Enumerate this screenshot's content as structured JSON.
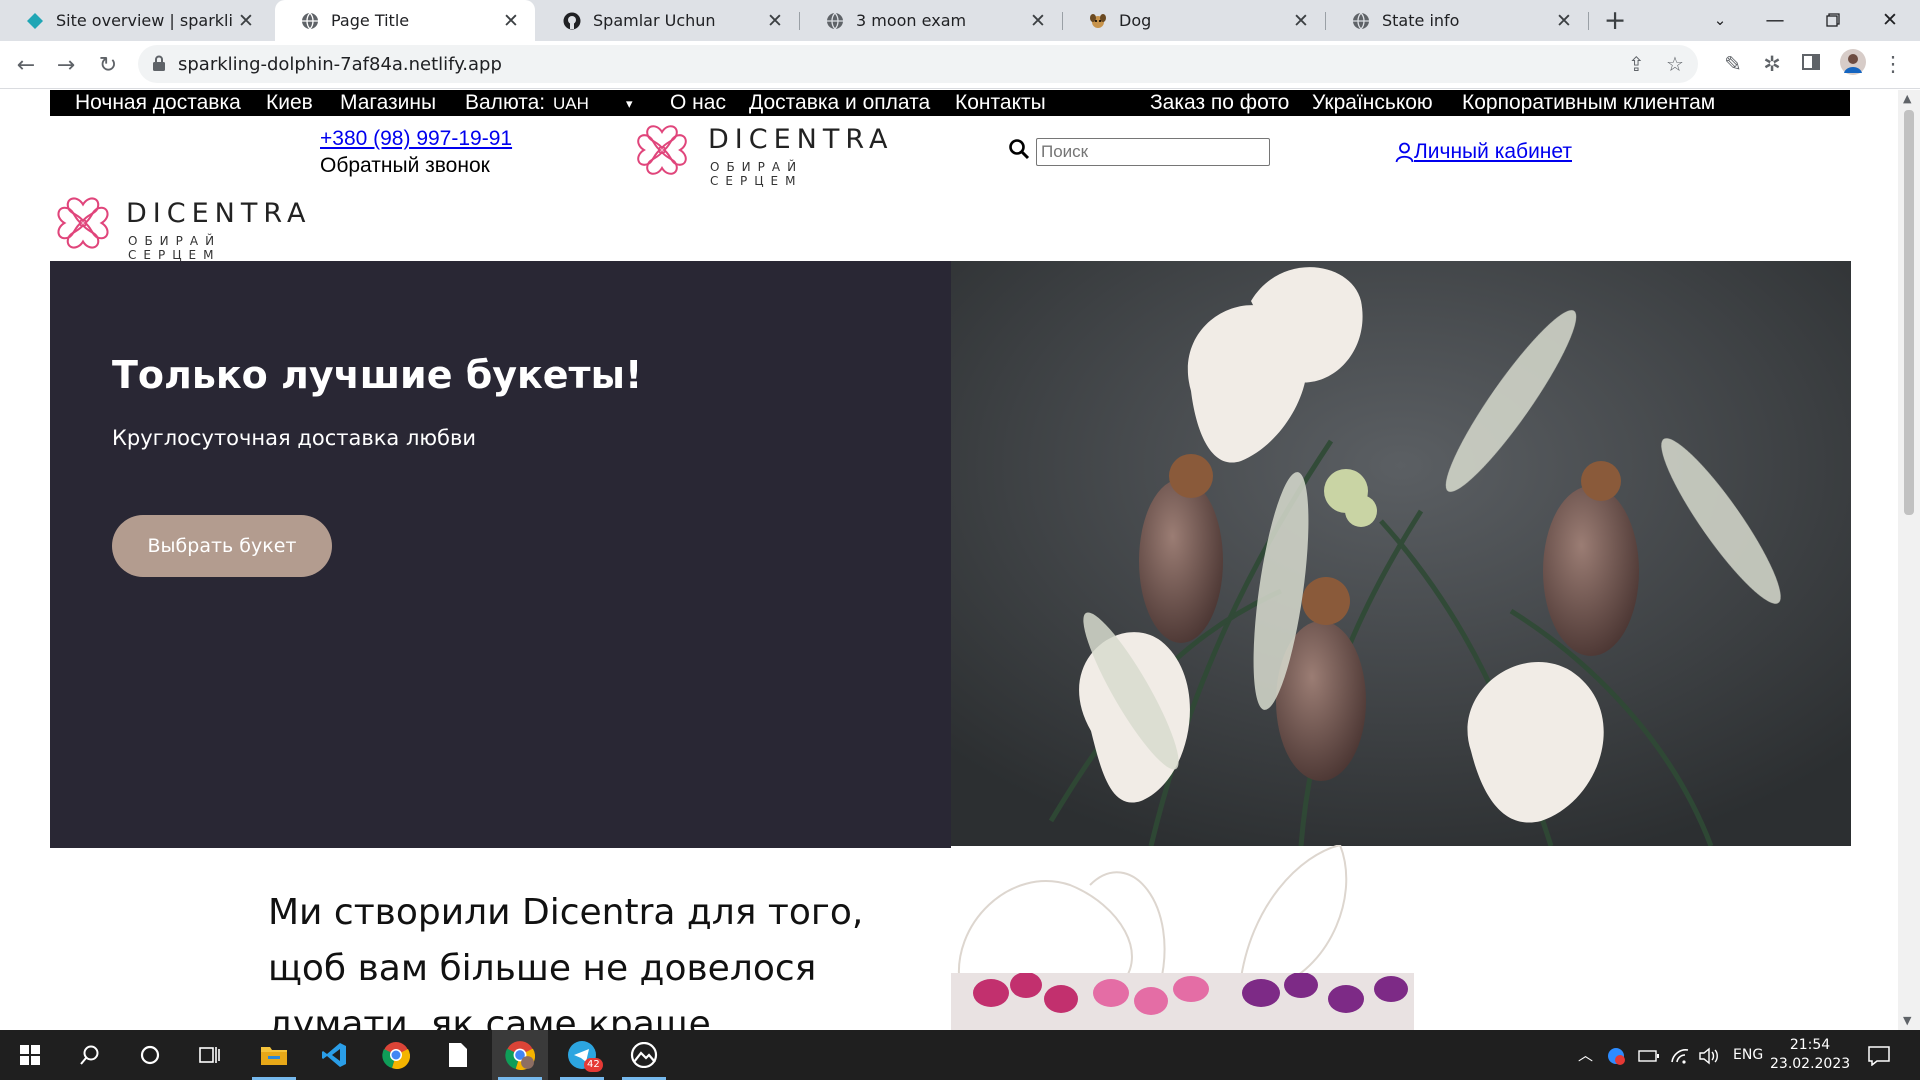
{
  "browser": {
    "tabs": [
      {
        "title": "Site overview | sparkling-dolphin",
        "icon": "netlify-icon",
        "active": false
      },
      {
        "title": "Page Title",
        "icon": "globe-icon",
        "active": true
      },
      {
        "title": "Spamlar Uchun",
        "icon": "github-icon",
        "active": false
      },
      {
        "title": "3 moon exam",
        "icon": "globe-icon",
        "active": false
      },
      {
        "title": "Dog",
        "icon": "dog-icon",
        "active": false
      },
      {
        "title": "State info",
        "icon": "globe-icon",
        "active": false
      }
    ],
    "url": "sparkling-dolphin-7af84a.netlify.app"
  },
  "site": {
    "topnav": {
      "items": [
        "Ночная доставка",
        "Киев",
        "Магазины",
        "Валюта:",
        "О нас",
        "Доставка и оплата",
        "Контакты",
        "Заказ по фото",
        "Українською",
        "Корпоративным клиентам"
      ],
      "currency_value": "UAH"
    },
    "header": {
      "phone": "+380 (98) 997-19-91",
      "callback": "Обратный звонок",
      "logo_word": "DICENTRA",
      "logo_tagline": "ОБИРАЙ СЕРЦЕМ",
      "search_placeholder": "Поиск",
      "account_label": "Личный кабинет"
    },
    "hero": {
      "title": "Только лучшие букеты!",
      "subtitle": "Круглосуточная доставка любви",
      "button": "Выбрать букет"
    },
    "about": {
      "text": "Ми створили Dicentra для того, щоб вам більше не довелося думати, як саме краще висловити"
    }
  },
  "taskbar": {
    "language": "ENG",
    "time": "21:54",
    "date": "23.02.2023",
    "telegram_badge": "42"
  },
  "colors": {
    "hero_bg": "#292734",
    "hero_button": "#b39c8f",
    "logo_pink": "#e0457b",
    "nav_bg": "#000000"
  }
}
